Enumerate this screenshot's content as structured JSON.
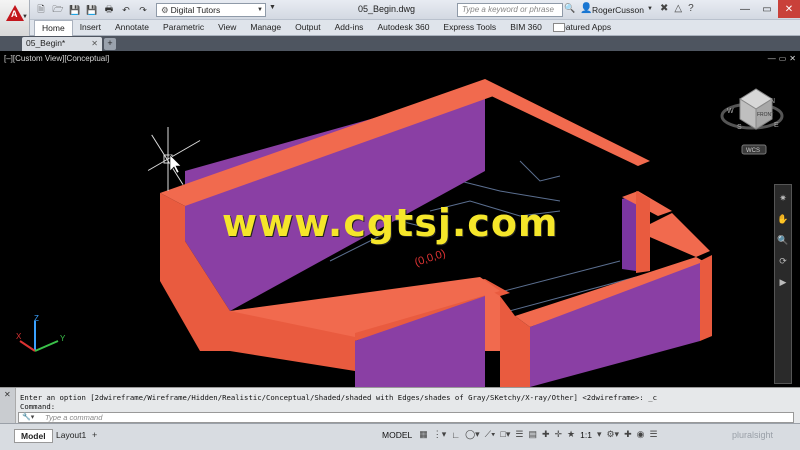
{
  "titlebar": {
    "workspace": "Digital Tutors",
    "document_title": "05_Begin.dwg",
    "search_placeholder": "Type a keyword or phrase",
    "user_name": "RogerCusson"
  },
  "ribbon": {
    "tabs": [
      "Home",
      "Insert",
      "Annotate",
      "Parametric",
      "View",
      "Manage",
      "Output",
      "Add-ins",
      "Autodesk 360",
      "Express Tools",
      "BIM 360",
      "Featured Apps"
    ],
    "active_tab": "Home"
  },
  "file_tabs": {
    "active": "05_Begin*"
  },
  "viewport": {
    "label": "[–][Custom View][Conceptual]",
    "viewcube_face": "FRONT",
    "wcs_label": "WCS",
    "compass": [
      "N",
      "W",
      "S",
      "E"
    ],
    "watermark": "www.cgtsj.com",
    "drawing_annotation": "(0,0,0)",
    "colors": {
      "wall_top": "#f16a4e",
      "wall_outer": "#e95b3f",
      "wall_inner": "#8a3fa4",
      "wall_inner_dark": "#6e3096",
      "floor_lines": "#5b6f90"
    }
  },
  "command_line": {
    "history_1": "Enter an option [2dwireframe/Wireframe/Hidden/Realistic/Conceptual/Shaded/shaded with Edges/shades of Gray/SKetchy/X-ray/Other] <2dwireframe>: _c",
    "history_2": "Command:",
    "input_placeholder": "Type a command"
  },
  "status_bar": {
    "layouts": [
      "Model",
      "Layout1"
    ],
    "model_button": "MODEL",
    "annotation_scale": "1:1",
    "brand": "pluralsight"
  }
}
